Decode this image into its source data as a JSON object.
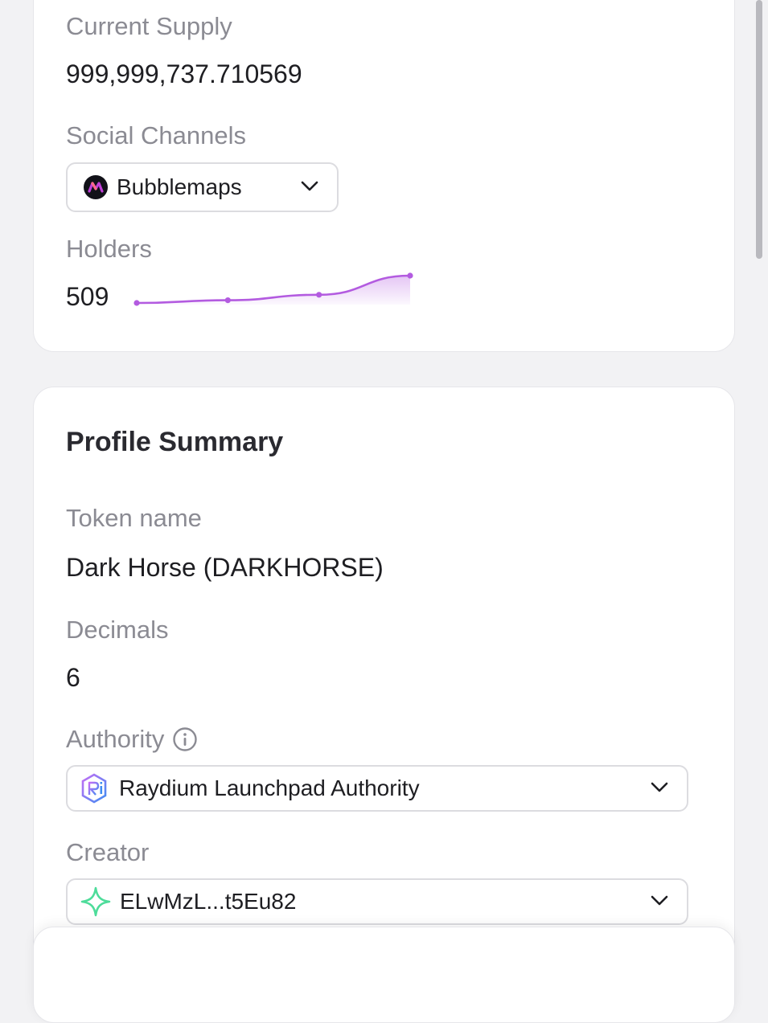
{
  "market_card": {
    "current_supply_label": "Current Supply",
    "current_supply_value": "999,999,737.710569",
    "social_channels_label": "Social Channels",
    "social_channel_selected": "Bubblemaps",
    "holders_label": "Holders",
    "holders_value": "509",
    "holders_trend": [
      0,
      1,
      3,
      10
    ]
  },
  "profile_summary": {
    "title": "Profile Summary",
    "token_name_label": "Token name",
    "token_name_value": "Dark Horse (DARKHORSE)",
    "decimals_label": "Decimals",
    "decimals_value": "6",
    "authority_label": "Authority",
    "authority_selected": "Raydium Launchpad Authority",
    "creator_label": "Creator",
    "creator_selected": "ELwMzL...t5Eu82"
  },
  "icons": {
    "social_channel": "bubblemaps-logo-icon",
    "authority_info": "info-icon",
    "authority_logo": "raydium-logo-icon",
    "creator_logo": "sparkle-star-icon",
    "dropdown": "chevron-down-icon"
  },
  "colors": {
    "sparkline": "#b35be0",
    "creator_icon": "#4ddc9a",
    "raydium_icon": "#6b6ff0"
  }
}
